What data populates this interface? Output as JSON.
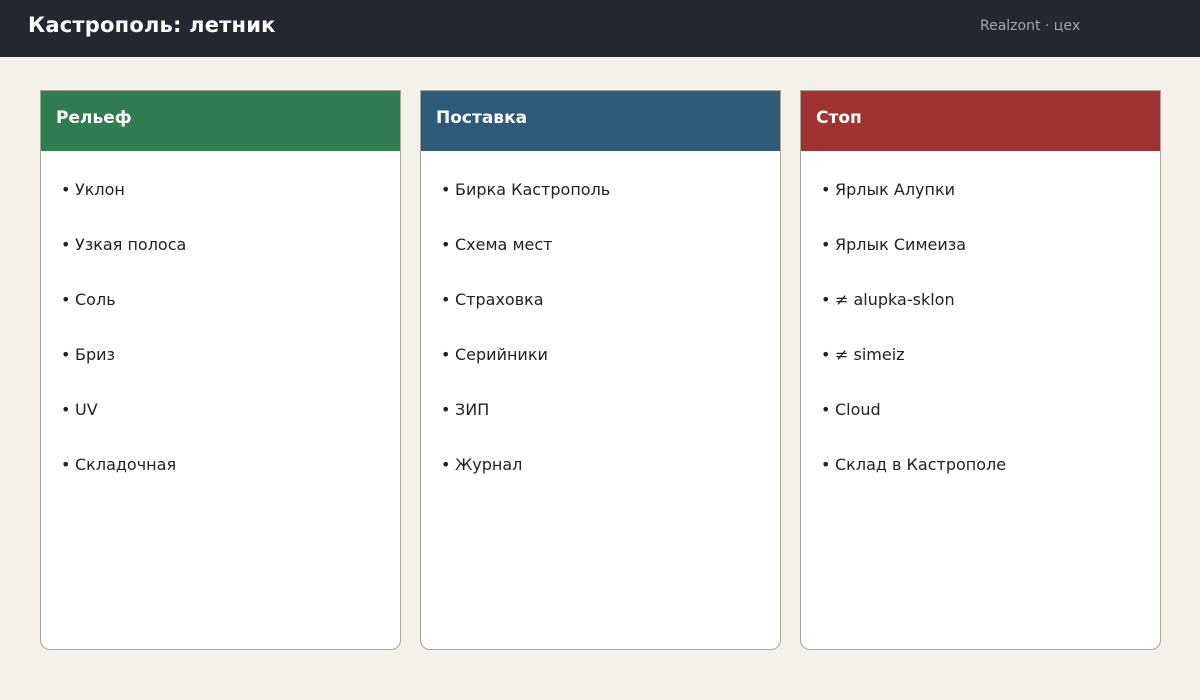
{
  "header": {
    "title": "Кастрополь: летник",
    "brand": "Realzont · цех"
  },
  "colors": {
    "topbar": "#232830",
    "background": "#f4f1ea",
    "relief": "#2f7d50",
    "supply": "#2e5a7a",
    "stop": "#a03232"
  },
  "cards": [
    {
      "title": "Рельеф",
      "color": "#2f7d50",
      "items": [
        "Уклон",
        "Узкая полоса",
        "Соль",
        "Бриз",
        "UV",
        "Складочная"
      ]
    },
    {
      "title": "Поставка",
      "color": "#2e5a7a",
      "items": [
        "Бирка Кастрополь",
        "Схема мест",
        "Страховка",
        "Серийники",
        "ЗИП",
        "Журнал"
      ]
    },
    {
      "title": "Стоп",
      "color": "#a03232",
      "items": [
        "Ярлык Алупки",
        "Ярлык Симеиза",
        "≠ alupka-sklon",
        "≠ simeiz",
        "Cloud",
        "Склад в Кастрополе"
      ]
    }
  ]
}
